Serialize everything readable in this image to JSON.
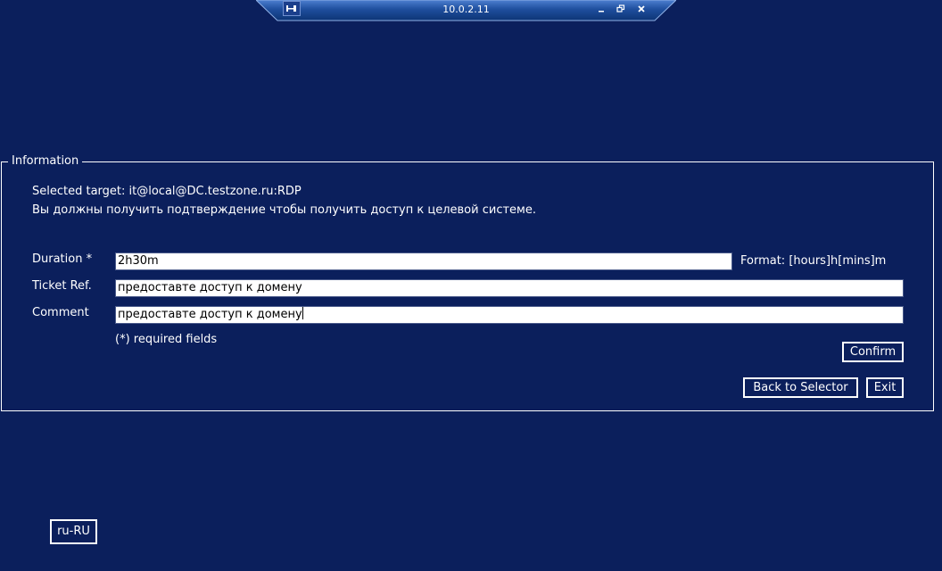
{
  "connection_bar": {
    "title": "10.0.2.11",
    "icons": [
      "pin-icon",
      "minimize-icon",
      "restore-icon",
      "close-icon"
    ]
  },
  "info": {
    "legend": "Information",
    "selected_target": "Selected target: it@local@DC.testzone.ru:RDP",
    "message": "Вы должны получить подтверждение чтобы получить доступ к целевой системе.",
    "duration_label": "Duration *",
    "duration_value": "2h30m",
    "duration_format": "Format: [hours]h[mins]m",
    "ticket_label": "Ticket Ref.",
    "ticket_value": "предоставте доступ к домену",
    "comment_label": "Comment",
    "comment_value": "предоставте доступ к домену",
    "required_note": "(*) required fields",
    "confirm_label": "Confirm",
    "back_label": "Back to Selector",
    "exit_label": "Exit"
  },
  "locale": {
    "label": "ru-RU"
  },
  "colors": {
    "background": "#0b1f5c",
    "bar_dark": "#0d3475",
    "bar_light": "#3f74c6",
    "text": "#ffffff"
  }
}
